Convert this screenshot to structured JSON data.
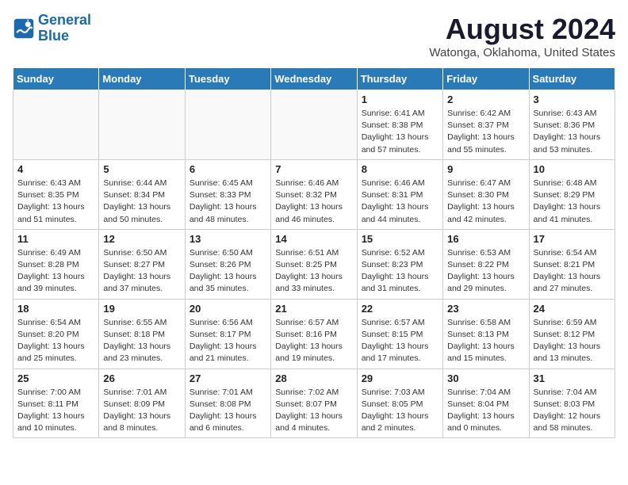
{
  "logo": {
    "line1": "General",
    "line2": "Blue"
  },
  "title": "August 2024",
  "subtitle": "Watonga, Oklahoma, United States",
  "days_of_week": [
    "Sunday",
    "Monday",
    "Tuesday",
    "Wednesday",
    "Thursday",
    "Friday",
    "Saturday"
  ],
  "weeks": [
    [
      {
        "day": "",
        "info": ""
      },
      {
        "day": "",
        "info": ""
      },
      {
        "day": "",
        "info": ""
      },
      {
        "day": "",
        "info": ""
      },
      {
        "day": "1",
        "info": "Sunrise: 6:41 AM\nSunset: 8:38 PM\nDaylight: 13 hours\nand 57 minutes."
      },
      {
        "day": "2",
        "info": "Sunrise: 6:42 AM\nSunset: 8:37 PM\nDaylight: 13 hours\nand 55 minutes."
      },
      {
        "day": "3",
        "info": "Sunrise: 6:43 AM\nSunset: 8:36 PM\nDaylight: 13 hours\nand 53 minutes."
      }
    ],
    [
      {
        "day": "4",
        "info": "Sunrise: 6:43 AM\nSunset: 8:35 PM\nDaylight: 13 hours\nand 51 minutes."
      },
      {
        "day": "5",
        "info": "Sunrise: 6:44 AM\nSunset: 8:34 PM\nDaylight: 13 hours\nand 50 minutes."
      },
      {
        "day": "6",
        "info": "Sunrise: 6:45 AM\nSunset: 8:33 PM\nDaylight: 13 hours\nand 48 minutes."
      },
      {
        "day": "7",
        "info": "Sunrise: 6:46 AM\nSunset: 8:32 PM\nDaylight: 13 hours\nand 46 minutes."
      },
      {
        "day": "8",
        "info": "Sunrise: 6:46 AM\nSunset: 8:31 PM\nDaylight: 13 hours\nand 44 minutes."
      },
      {
        "day": "9",
        "info": "Sunrise: 6:47 AM\nSunset: 8:30 PM\nDaylight: 13 hours\nand 42 minutes."
      },
      {
        "day": "10",
        "info": "Sunrise: 6:48 AM\nSunset: 8:29 PM\nDaylight: 13 hours\nand 41 minutes."
      }
    ],
    [
      {
        "day": "11",
        "info": "Sunrise: 6:49 AM\nSunset: 8:28 PM\nDaylight: 13 hours\nand 39 minutes."
      },
      {
        "day": "12",
        "info": "Sunrise: 6:50 AM\nSunset: 8:27 PM\nDaylight: 13 hours\nand 37 minutes."
      },
      {
        "day": "13",
        "info": "Sunrise: 6:50 AM\nSunset: 8:26 PM\nDaylight: 13 hours\nand 35 minutes."
      },
      {
        "day": "14",
        "info": "Sunrise: 6:51 AM\nSunset: 8:25 PM\nDaylight: 13 hours\nand 33 minutes."
      },
      {
        "day": "15",
        "info": "Sunrise: 6:52 AM\nSunset: 8:23 PM\nDaylight: 13 hours\nand 31 minutes."
      },
      {
        "day": "16",
        "info": "Sunrise: 6:53 AM\nSunset: 8:22 PM\nDaylight: 13 hours\nand 29 minutes."
      },
      {
        "day": "17",
        "info": "Sunrise: 6:54 AM\nSunset: 8:21 PM\nDaylight: 13 hours\nand 27 minutes."
      }
    ],
    [
      {
        "day": "18",
        "info": "Sunrise: 6:54 AM\nSunset: 8:20 PM\nDaylight: 13 hours\nand 25 minutes."
      },
      {
        "day": "19",
        "info": "Sunrise: 6:55 AM\nSunset: 8:18 PM\nDaylight: 13 hours\nand 23 minutes."
      },
      {
        "day": "20",
        "info": "Sunrise: 6:56 AM\nSunset: 8:17 PM\nDaylight: 13 hours\nand 21 minutes."
      },
      {
        "day": "21",
        "info": "Sunrise: 6:57 AM\nSunset: 8:16 PM\nDaylight: 13 hours\nand 19 minutes."
      },
      {
        "day": "22",
        "info": "Sunrise: 6:57 AM\nSunset: 8:15 PM\nDaylight: 13 hours\nand 17 minutes."
      },
      {
        "day": "23",
        "info": "Sunrise: 6:58 AM\nSunset: 8:13 PM\nDaylight: 13 hours\nand 15 minutes."
      },
      {
        "day": "24",
        "info": "Sunrise: 6:59 AM\nSunset: 8:12 PM\nDaylight: 13 hours\nand 13 minutes."
      }
    ],
    [
      {
        "day": "25",
        "info": "Sunrise: 7:00 AM\nSunset: 8:11 PM\nDaylight: 13 hours\nand 10 minutes."
      },
      {
        "day": "26",
        "info": "Sunrise: 7:01 AM\nSunset: 8:09 PM\nDaylight: 13 hours\nand 8 minutes."
      },
      {
        "day": "27",
        "info": "Sunrise: 7:01 AM\nSunset: 8:08 PM\nDaylight: 13 hours\nand 6 minutes."
      },
      {
        "day": "28",
        "info": "Sunrise: 7:02 AM\nSunset: 8:07 PM\nDaylight: 13 hours\nand 4 minutes."
      },
      {
        "day": "29",
        "info": "Sunrise: 7:03 AM\nSunset: 8:05 PM\nDaylight: 13 hours\nand 2 minutes."
      },
      {
        "day": "30",
        "info": "Sunrise: 7:04 AM\nSunset: 8:04 PM\nDaylight: 13 hours\nand 0 minutes."
      },
      {
        "day": "31",
        "info": "Sunrise: 7:04 AM\nSunset: 8:03 PM\nDaylight: 12 hours\nand 58 minutes."
      }
    ]
  ]
}
